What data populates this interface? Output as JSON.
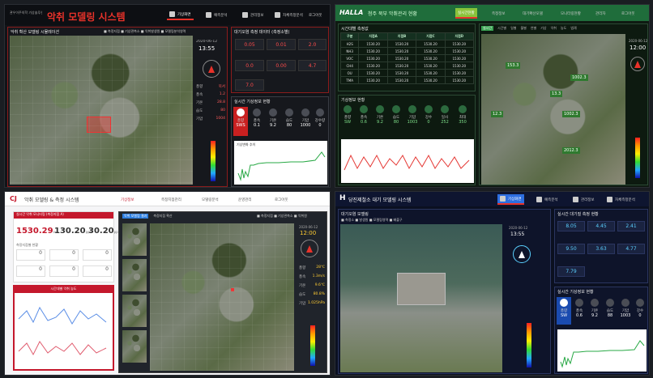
{
  "p1": {
    "logo": "관우이주의학\n기상솔루션",
    "title": "악취 모델링 시스템",
    "nav": [
      "기상화면",
      "예측분석",
      "관리정보",
      "자체측정분석",
      "로그아웃"
    ],
    "map_title": "악취 확산 모델링 시뮬레이션",
    "legend": [
      "■ 측정지점",
      "■ 기상관측소",
      "■ 악취발생원",
      "■ 모델링분석영역"
    ],
    "date": "2020-06-12",
    "time": "13:55",
    "kv": [
      [
        "풍향",
        "북서"
      ],
      [
        "풍속",
        "1.2"
      ],
      [
        "기온",
        "28.8"
      ],
      [
        "습도",
        "80"
      ],
      [
        "기압",
        "1004"
      ]
    ],
    "right_title": "대기오염 측정 데이터 (측정소별)",
    "cells": [
      "0.05",
      "0.01",
      "2.0",
      "0.0",
      "0.00",
      "4.7",
      "7.0"
    ],
    "weather_title": "실시간 기상정보 현황",
    "weather": [
      [
        "풍향",
        "SWS"
      ],
      [
        "풍속",
        "0.1"
      ],
      [
        "기온",
        "9.2"
      ],
      [
        "습도",
        "80"
      ],
      [
        "기압",
        "1000"
      ],
      [
        "강수량",
        "0"
      ]
    ],
    "chart_label": "기상변화 추이"
  },
  "p2": {
    "logo": "HALLA",
    "title": "청주 북부 악취관리 현황",
    "nav": [
      "실시간현황",
      "측정정보",
      "대기확산모델",
      "모니터링현황",
      "관리자",
      "로그아웃"
    ],
    "table_title": "시간대별 측정값",
    "headers": [
      "구분",
      "지점A",
      "지점B",
      "지점C",
      "지점D"
    ],
    "rows": [
      [
        "1530.20",
        "1530.20",
        "1530.20",
        "1530.20"
      ],
      [
        "1530.20",
        "1530.20",
        "1530.20",
        "1530.20"
      ],
      [
        "1530.20",
        "1530.20",
        "1530.20",
        "1530.20"
      ],
      [
        "1530.20",
        "1530.20",
        "1530.20",
        "1530.20"
      ],
      [
        "1530.20",
        "1530.20",
        "1530.20",
        "1530.20"
      ],
      [
        "1530.20",
        "1530.20",
        "1530.20",
        "1530.20"
      ]
    ],
    "row_labels": [
      "H2S",
      "NH3",
      "VOC",
      "CH4",
      "OU",
      "TMA"
    ],
    "weather_title": "기상정보 현황",
    "weather": [
      [
        "풍향",
        "SW"
      ],
      [
        "풍속",
        "0.6"
      ],
      [
        "기온",
        "9.2"
      ],
      [
        "습도",
        "80"
      ],
      [
        "기압",
        "1003"
      ],
      [
        "강수",
        "0"
      ],
      [
        "일사",
        "252"
      ],
      [
        "최대",
        "350"
      ]
    ],
    "map_tabs": [
      "실시간",
      "시간별",
      "일별",
      "월별",
      "연별",
      "기상",
      "악취",
      "농도",
      "범례"
    ],
    "map_labels": [
      "153.3",
      "1002.3",
      "12.3",
      "1002.3",
      "2012.3",
      "13.3"
    ],
    "time": "12:00",
    "date": "2020-06-12"
  },
  "p3": {
    "logo": "CJ",
    "title": "악취 모델링 & 측정 시스템",
    "nav": [
      "기상정보",
      "측정지점관리",
      "모델링분석",
      "운영관리",
      "로그아웃"
    ],
    "stat_header": "실시간 악취 모니터링 (측정지점 A)",
    "stats": [
      [
        "1530.29",
        "ou"
      ],
      [
        "130.20",
        "ppm"
      ],
      [
        "30.20",
        "ppb"
      ]
    ],
    "sub_label": "측정지점별 현황",
    "small": [
      "0",
      "0",
      "0",
      "0",
      "0",
      "0"
    ],
    "chart_title": "시간대별 악취 농도",
    "map_tabs": [
      "악취 모델링 결과",
      "측정지점 확산"
    ],
    "map_top": [
      "■ 측정지점",
      "■ 기상관측소",
      "■ 악취원"
    ],
    "date": "2020-06-12",
    "time": "12:00",
    "kv": [
      [
        "풍향",
        "28"
      ],
      [
        "풍속",
        "1.3"
      ],
      [
        "기온",
        "9.6"
      ],
      [
        "습도",
        "80.8"
      ],
      [
        "기압",
        "1.025"
      ]
    ],
    "units": [
      "℃",
      "m/s",
      "℃",
      "%",
      "hPa"
    ]
  },
  "p4": {
    "logo": "H",
    "title": "당진제철소 대기 모델링 시스템",
    "nav": [
      "기상화면",
      "예측분석",
      "관리정보",
      "자체측정분석"
    ],
    "map_title": "대기오염 모델링",
    "legend": [
      "■ 측정소",
      "■ 발생원",
      "■ 모델링영역",
      "■ 배출구"
    ],
    "right_title": "실시간 대기질 측정 현황",
    "cells": [
      "8.05",
      "4.45",
      "2.41",
      "9.50",
      "3.63",
      "4.77",
      "7.79"
    ],
    "weather_title": "실시간 기상정보 현황",
    "weather": [
      [
        "풍향",
        "SW"
      ],
      [
        "풍속",
        "0.6"
      ],
      [
        "기온",
        "9.2"
      ],
      [
        "습도",
        "88"
      ],
      [
        "기압",
        "1003"
      ],
      [
        "강수",
        "0"
      ]
    ],
    "date": "2020-06-12",
    "time": "13:55"
  }
}
